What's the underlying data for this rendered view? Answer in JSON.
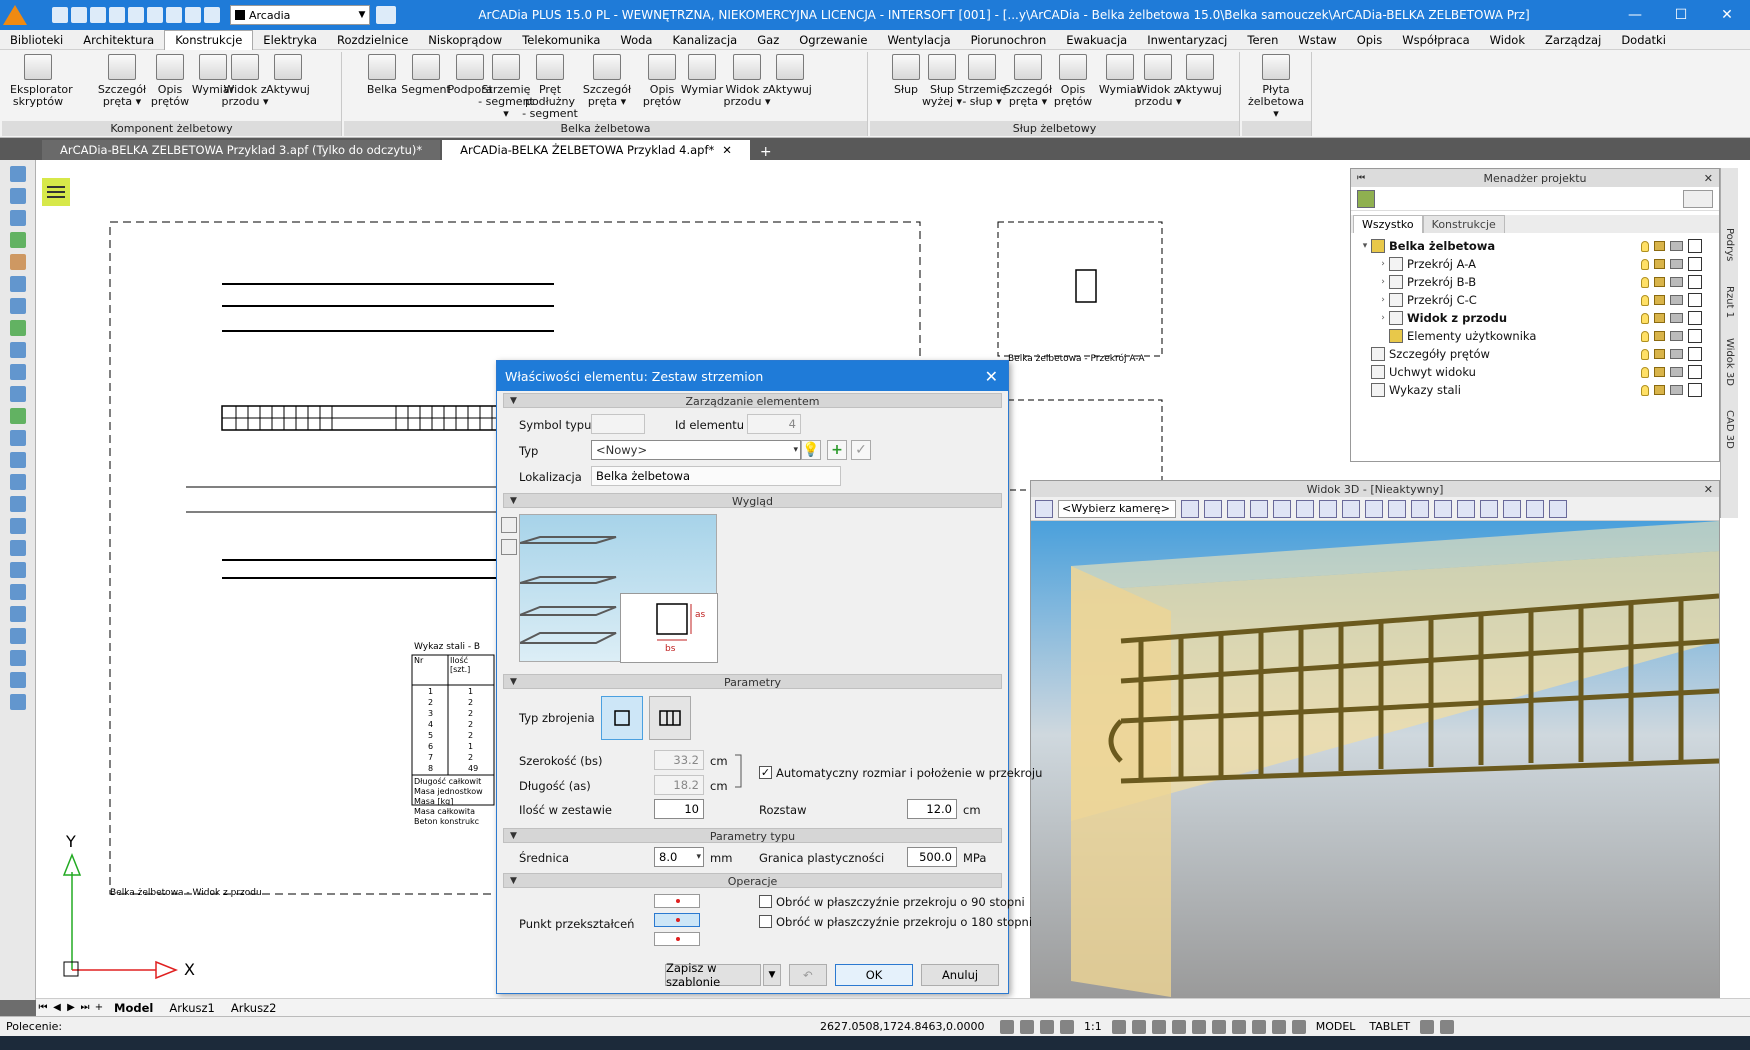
{
  "app": {
    "title": "ArCADia PLUS 15.0 PL - WEWNĘTRZNA, NIEKOMERCYJNA LICENCJA - INTERSOFT [001] - [...y\\ArCADia - Belka żelbetowa 15.0\\Belka samouczek\\ArCADia-BELKA ZELBETOWA Prz]",
    "layer_combo": "Arcadia",
    "window_buttons": [
      "—",
      "☐",
      "✕"
    ]
  },
  "menu": [
    "Biblioteki",
    "Architektura",
    "Konstrukcje",
    "Elektryka",
    "Rozdzielnice",
    "Niskoprądow",
    "Telekomunika",
    "Woda",
    "Kanalizacja",
    "Gaz",
    "Ogrzewanie",
    "Wentylacja",
    "Piorunochron",
    "Ewakuacja",
    "Inwentaryzacj",
    "Teren",
    "Wstaw",
    "Opis",
    "Współpraca",
    "Widok",
    "Zarządzaj",
    "Dodatki"
  ],
  "menu_active_index": 2,
  "ribbon": {
    "groups": [
      {
        "label": "Komponent żelbetowy",
        "buttons": [
          "Eksplorator skryptów",
          "Szczegół pręta ▾",
          "Opis prętów",
          "Wymiar",
          "Widok z przodu ▾",
          "Aktywuj"
        ]
      },
      {
        "label": "Belka żelbetowa",
        "buttons": [
          "Belka",
          "Segment",
          "Podpora",
          "Strzemię - segment ▾",
          "Pręt podłużny - segment ▾",
          "Szczegół pręta ▾",
          "Opis prętów",
          "Wymiar",
          "Widok z przodu ▾",
          "Aktywuj"
        ]
      },
      {
        "label": "Słup żelbetowy",
        "buttons": [
          "Słup",
          "Słup wyżej ▾",
          "Strzemię - słup ▾",
          "Szczegół pręta ▾",
          "Opis prętów",
          "Wymiar",
          "Widok z przodu ▾",
          "Aktywuj"
        ]
      },
      {
        "label": "",
        "buttons": [
          "Płyta żelbetowa ▾"
        ]
      }
    ]
  },
  "doc_tabs": [
    {
      "label": "ArCADia-BELKA ZELBETOWA Przyklad 3.apf (Tylko do odczytu)*",
      "active": false
    },
    {
      "label": "ArCADia-BELKA ŻELBETOWA Przyklad 4.apf*",
      "active": true
    }
  ],
  "drawing": {
    "front_view_label": "Belka żelbetowa - Widok z przodu",
    "section_label": "Belka żelbetowa - Przekrój A-A",
    "steel_table_label": "Wykaz stali - B",
    "steel_table_header": [
      "Nr",
      "Ilość [szt.]"
    ],
    "steel_table_rows": [
      [
        "1",
        "1"
      ],
      [
        "2",
        "2"
      ],
      [
        "3",
        "2"
      ],
      [
        "4",
        "2"
      ],
      [
        "5",
        "2"
      ],
      [
        "6",
        "1"
      ],
      [
        "7",
        "2"
      ],
      [
        "8",
        "49"
      ]
    ],
    "steel_table_footer": [
      "Długość całkowit",
      "Masa jednostkow",
      "Masa [kg]",
      "Masa całkowita",
      "Beton konstrukc"
    ],
    "axis_y": "Y",
    "axis_x": "X"
  },
  "sheets": [
    "Model",
    "Arkusz1",
    "Arkusz2"
  ],
  "status": {
    "command_label": "Polecenie:",
    "coords": "2627.0508,1724.8463,0.0000",
    "scale": "1:1",
    "mode_model": "MODEL",
    "mode_tablet": "TABLET"
  },
  "project_manager": {
    "title": "Menadżer projektu",
    "tabs": [
      "Wszystko",
      "Konstrukcje"
    ],
    "tree": [
      {
        "label": "Belka żelbetowa",
        "level": 0,
        "bold": true,
        "expander": "▾",
        "icon": "gold"
      },
      {
        "label": "Przekrój A-A",
        "level": 1,
        "bold": false,
        "expander": "›",
        "icon": "plain"
      },
      {
        "label": "Przekrój B-B",
        "level": 1,
        "bold": false,
        "expander": "›",
        "icon": "plain"
      },
      {
        "label": "Przekrój C-C",
        "level": 1,
        "bold": false,
        "expander": "›",
        "icon": "plain"
      },
      {
        "label": "Widok z przodu",
        "level": 1,
        "bold": true,
        "expander": "›",
        "icon": "plain"
      },
      {
        "label": "Elementy użytkownika",
        "level": 1,
        "bold": false,
        "expander": "",
        "icon": "gold"
      },
      {
        "label": "Szczegóły prętów",
        "level": 0,
        "bold": false,
        "expander": "",
        "icon": "plain"
      },
      {
        "label": "Uchwyt widoku",
        "level": 0,
        "bold": false,
        "expander": "",
        "icon": "plain"
      },
      {
        "label": "Wykazy stali",
        "level": 0,
        "bold": false,
        "expander": "",
        "icon": "plain"
      }
    ],
    "side_tabs": [
      "Podrys",
      "Rzut 1",
      "Widok 3D",
      "CAD 3D"
    ]
  },
  "view3d": {
    "title": "Widok 3D - [Nieaktywny]",
    "camera_combo": "<Wybierz kamerę>"
  },
  "dialog": {
    "title": "Właściwości elementu: Zestaw strzemion",
    "sections": {
      "management": "Zarządzanie elementem",
      "appearance": "Wygląd",
      "parameters": "Parametry",
      "type_parameters": "Parametry typu",
      "operations": "Operacje"
    },
    "management": {
      "symbol_label": "Symbol typu",
      "symbol_value": "",
      "id_label": "Id elementu",
      "id_value": "4",
      "type_label": "Typ",
      "type_value": "<Nowy>",
      "location_label": "Lokalizacja",
      "location_value": "Belka żelbetowa"
    },
    "preview": {
      "b_label": "bs",
      "a_label": "as"
    },
    "parameters": {
      "reinforcement_type_label": "Typ zbrojenia",
      "width_label": "Szerokość (bs)",
      "width_value": "33.2",
      "width_unit": "cm",
      "length_label": "Długość (as)",
      "length_value": "18.2",
      "length_unit": "cm",
      "auto_label": "Automatyczny rozmiar i położenie w przekroju",
      "auto_checked": true,
      "count_label": "Ilość w zestawie",
      "count_value": "10",
      "spacing_label": "Rozstaw",
      "spacing_value": "12.0",
      "spacing_unit": "cm"
    },
    "type_parameters": {
      "diameter_label": "Średnica",
      "diameter_value": "8.0",
      "diameter_unit": "mm",
      "yield_label": "Granica plastyczności",
      "yield_value": "500.0",
      "yield_unit": "MPa"
    },
    "operations": {
      "transform_point_label": "Punkt przekształceń",
      "rotate90_label": "Obróć w płaszczyźnie przekroju o 90 stopni",
      "rotate180_label": "Obróć w płaszczyźnie przekroju o 180 stopni",
      "rotate90_checked": false,
      "rotate180_checked": false
    },
    "buttons": {
      "save_template": "Zapisz w szablonie",
      "ok": "OK",
      "cancel": "Anuluj"
    }
  },
  "colors": {
    "accent": "#1f7bd8",
    "dialog_title": "#1f7bd8",
    "rebar": "#6b5a1e",
    "concrete": "#f2dea3"
  }
}
